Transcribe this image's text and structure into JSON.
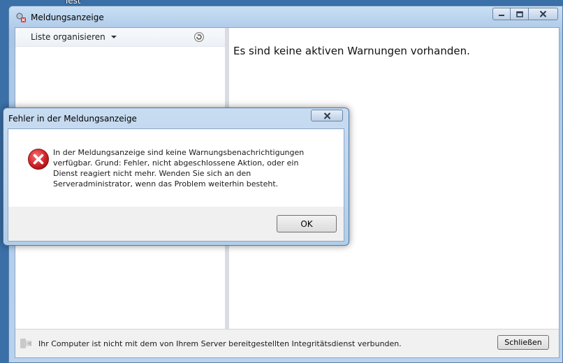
{
  "desktop": {
    "label": "Test"
  },
  "main_window": {
    "title": "Meldungsanzeige",
    "left_toolbar": {
      "organize_label": "Liste organisieren"
    },
    "right_pane": {
      "message": "Es sind keine aktiven Warnungen vorhanden."
    },
    "status_bar": {
      "text": "Ihr Computer ist nicht mit dem von Ihrem Server bereitgestellten Integritätsdienst verbunden.",
      "close_label": "Schließen"
    }
  },
  "error_dialog": {
    "title": "Fehler in der Meldungsanzeige",
    "message": "In der Meldungsanzeige sind keine Warnungsbenachrichtigungen verfügbar. Grund: Fehler, nicht abgeschlossene Aktion, oder ein Dienst reagiert nicht mehr. Wenden Sie sich an den Serveradministrator, wenn das Problem weiterhin besteht.",
    "ok_label": "OK"
  },
  "colors": {
    "error_red": "#d8262b",
    "window_frame": "#b9d3ee"
  },
  "icons": [
    "app-icon",
    "minimize-icon",
    "maximize-icon",
    "close-icon",
    "refresh-icon",
    "health-service-icon",
    "error-icon"
  ]
}
